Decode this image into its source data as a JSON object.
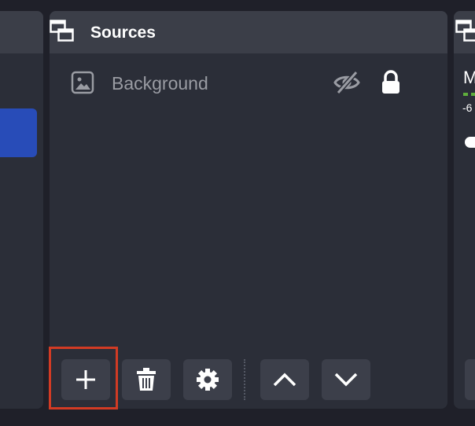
{
  "sources_dock": {
    "title": "Sources",
    "items": [
      {
        "label": "Background",
        "icon": "image-icon",
        "visible": false,
        "locked": true
      }
    ],
    "toolbar": {
      "add": "add-source-button",
      "remove": "remove-source-button",
      "properties": "source-properties-button",
      "move_up": "move-up-button",
      "move_down": "move-down-button"
    }
  },
  "mixer_dock": {
    "label_fragment": "M",
    "db_fragment": "-6"
  },
  "colors": {
    "background": "#1f2029",
    "panel": "#2b2e38",
    "header": "#3b3e48",
    "button": "#3c3f4a",
    "selected": "#284cb8",
    "highlight": "#d23b24"
  }
}
